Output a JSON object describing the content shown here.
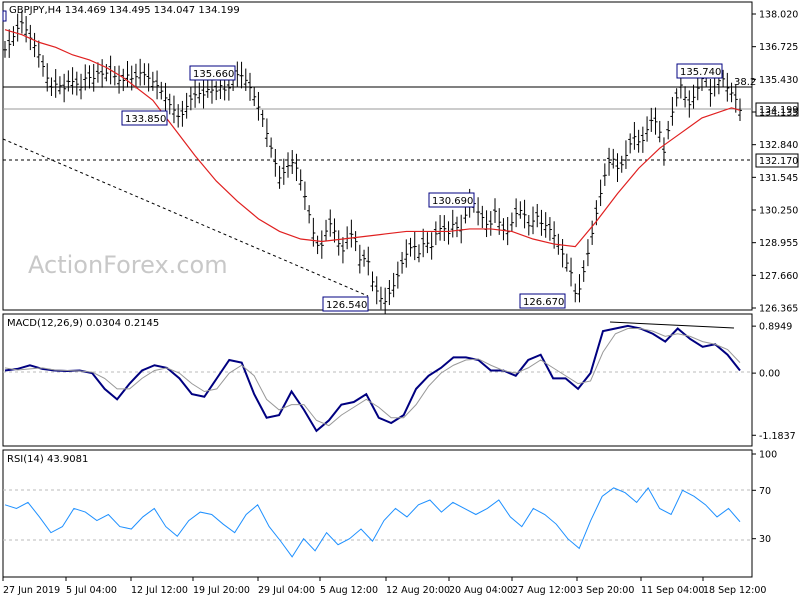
{
  "header": {
    "symbol_info": "GBPJPY,H4  134.469 134.495 134.047 134.199",
    "macd_info": "MACD(12,26,9) 0.0304 0.2145",
    "rsi_info": "RSI(14) 43.9081"
  },
  "watermark": "ActionForex.com",
  "colors": {
    "price_bars": "#000000",
    "ma_line": "#e02020",
    "macd_line": "#000080",
    "signal_line": "#999999",
    "rsi_line": "#1e90ff",
    "grid": "#bbbbbb",
    "callout_border": "#000080"
  },
  "chart_data": [
    {
      "type": "line",
      "name": "price",
      "title": "GBPJPY,H4",
      "y_ticks": [
        138.02,
        136.725,
        135.43,
        134.135,
        132.84,
        131.545,
        130.25,
        128.955,
        127.66,
        126.365
      ],
      "ylim": [
        126.365,
        138.02
      ],
      "x_ticks": [
        "27 Jun 2019",
        "5 Jul 04:00",
        "12 Jul 12:00",
        "19 Jul 20:00",
        "29 Jul 04:00",
        "5 Aug 12:00",
        "12 Aug 20:00",
        "20 Aug 04:00",
        "27 Aug 12:00",
        "3 Sep 20:00",
        "11 Sep 04:00",
        "18 Sep 12:00"
      ],
      "series": [
        {
          "values": [
            136.6,
            136.9,
            137.4,
            137.7,
            137.2,
            136.8,
            136.3,
            135.6,
            135.1,
            135.3,
            135.0,
            135.4,
            135.3,
            135.1,
            135.6,
            135.4,
            135.7,
            135.6,
            135.8,
            135.5,
            135.3,
            135.6,
            135.4,
            135.7,
            135.6,
            135.4,
            135.2,
            134.9,
            134.5,
            134.2,
            133.85,
            134.3,
            134.7,
            134.9,
            134.8,
            135.1,
            134.9,
            135.2,
            134.9,
            135.4,
            135.66,
            135.5,
            135.1,
            134.6,
            134.0,
            133.2,
            132.4,
            131.5,
            131.8,
            132.2,
            131.9,
            131.2,
            130.2,
            129.2,
            128.6,
            129.4,
            129.8,
            129.0,
            128.6,
            129.4,
            129.1,
            128.1,
            128.5,
            127.4,
            126.9,
            126.54,
            127.0,
            127.4,
            128.1,
            128.6,
            128.9,
            128.5,
            129.1,
            128.7,
            129.4,
            129.6,
            129.3,
            129.8,
            129.3,
            130.1,
            130.69,
            130.2,
            129.9,
            129.5,
            130.2,
            129.6,
            129.3,
            129.8,
            130.3,
            130.1,
            129.5,
            130.1,
            129.7,
            129.6,
            129.3,
            128.8,
            128.3,
            127.8,
            126.67,
            127.6,
            128.6,
            129.7,
            130.8,
            131.8,
            132.4,
            131.9,
            132.1,
            132.8,
            133.2,
            132.8,
            133.4,
            133.9,
            133.6,
            132.5,
            133.8,
            134.6,
            135.3,
            134.3,
            134.7,
            135.2,
            135.74,
            134.8,
            135.3,
            135.5,
            135.0,
            134.8,
            134.2
          ]
        },
        {
          "name": "SMA",
          "values": [
            137.4,
            137.2,
            136.9,
            136.7,
            136.4,
            136.2,
            135.9,
            135.5,
            134.6,
            133.5,
            132.4,
            131.4,
            130.6,
            129.9,
            129.4,
            129.1,
            129.0,
            129.1,
            129.2,
            129.3,
            129.4,
            129.4,
            129.4,
            129.5,
            129.5,
            129.4,
            129.1,
            128.9,
            128.8,
            129.8,
            130.9,
            131.9,
            132.7,
            133.3,
            133.9,
            134.3,
            134.2
          ]
        }
      ],
      "ma_x_index": [
        0,
        4,
        8,
        12,
        16,
        20,
        24,
        28,
        35,
        40,
        45,
        50,
        55,
        60,
        65,
        70,
        75,
        80,
        85,
        90,
        95,
        100,
        105,
        110,
        115,
        120,
        125,
        130,
        135,
        140,
        145,
        150,
        155,
        160,
        165,
        172,
        174
      ]
    },
    {
      "type": "line",
      "name": "MACD",
      "y_ticks": [
        0.8949,
        0.0,
        -1.1837
      ],
      "ylim": [
        -1.35,
        1.05
      ],
      "series": [
        {
          "name": "MACD",
          "values": [
            0.05,
            0.08,
            0.15,
            0.08,
            0.05,
            0.04,
            0.05,
            0.0,
            -0.3,
            -0.5,
            -0.2,
            0.05,
            0.15,
            0.1,
            -0.1,
            -0.4,
            -0.45,
            -0.1,
            0.25,
            0.2,
            -0.4,
            -0.85,
            -0.8,
            -0.35,
            -0.7,
            -1.1,
            -0.9,
            -0.6,
            -0.55,
            -0.4,
            -0.85,
            -0.95,
            -0.8,
            -0.3,
            -0.05,
            0.1,
            0.3,
            0.3,
            0.25,
            0.05,
            0.05,
            -0.05,
            0.25,
            0.35,
            -0.1,
            -0.1,
            -0.3,
            0.0,
            0.8,
            0.85,
            0.9,
            0.85,
            0.75,
            0.6,
            0.85,
            0.65,
            0.5,
            0.55,
            0.35,
            0.05
          ]
        },
        {
          "name": "Signal",
          "values": [
            0.1,
            0.06,
            0.08,
            0.1,
            0.06,
            0.05,
            0.04,
            0.02,
            -0.1,
            -0.3,
            -0.3,
            -0.1,
            0.05,
            0.1,
            0.0,
            -0.2,
            -0.35,
            -0.3,
            0.0,
            0.15,
            -0.05,
            -0.5,
            -0.7,
            -0.6,
            -0.6,
            -0.9,
            -1.0,
            -0.8,
            -0.65,
            -0.5,
            -0.65,
            -0.85,
            -0.85,
            -0.6,
            -0.25,
            0.0,
            0.15,
            0.25,
            0.27,
            0.15,
            0.05,
            0.0,
            0.1,
            0.25,
            0.1,
            -0.05,
            -0.2,
            -0.15,
            0.4,
            0.75,
            0.85,
            0.85,
            0.8,
            0.7,
            0.75,
            0.7,
            0.6,
            0.55,
            0.45,
            0.2
          ]
        }
      ]
    },
    {
      "type": "line",
      "name": "RSI(14)",
      "y_ticks": [
        100,
        70,
        30
      ],
      "ylim": [
        0,
        100
      ],
      "series": [
        {
          "name": "RSI",
          "values": [
            58,
            55,
            60,
            48,
            35,
            40,
            55,
            52,
            45,
            50,
            40,
            38,
            48,
            55,
            40,
            32,
            45,
            52,
            50,
            42,
            35,
            50,
            58,
            40,
            28,
            15,
            30,
            20,
            35,
            25,
            30,
            38,
            28,
            45,
            55,
            48,
            58,
            62,
            52,
            60,
            55,
            50,
            55,
            62,
            48,
            40,
            55,
            50,
            42,
            30,
            22,
            45,
            65,
            72,
            68,
            60,
            72,
            55,
            50,
            70,
            65,
            58,
            48,
            55,
            44
          ]
        }
      ]
    }
  ]
}
